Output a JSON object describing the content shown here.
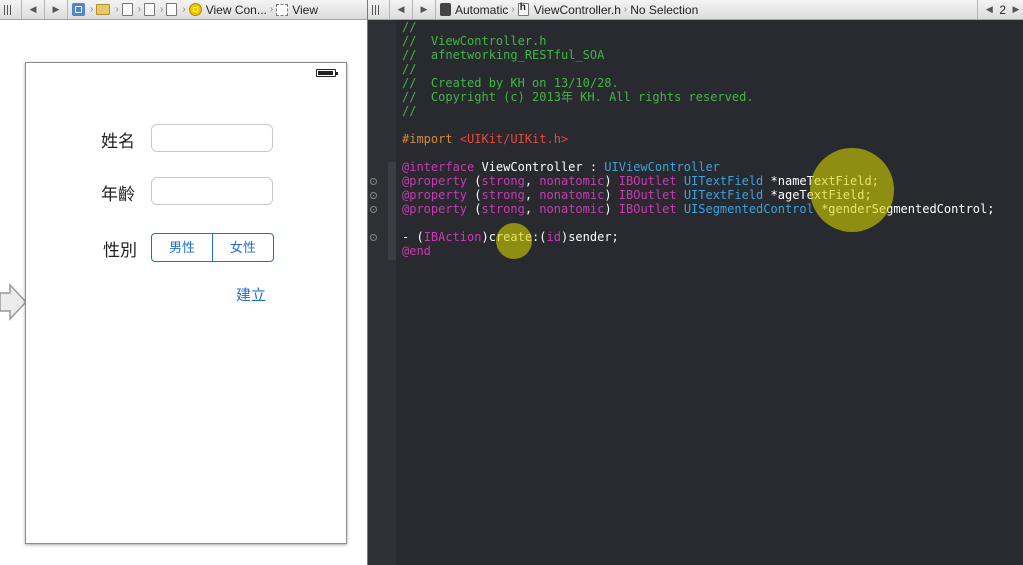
{
  "left_jumpbar": {
    "breadcrumb_vc": "View Con...",
    "breadcrumb_view": "View"
  },
  "right_jumpbar": {
    "automatic": "Automatic",
    "file": "ViewController.h",
    "selection": "No Selection",
    "counterpart_count": "2"
  },
  "form": {
    "name_label": "姓名",
    "age_label": "年齡",
    "gender_label": "性別",
    "segments": [
      "男性",
      "女性"
    ],
    "create_label": "建立"
  },
  "code": {
    "lines": [
      [
        {
          "t": "//",
          "c": "comment"
        }
      ],
      [
        {
          "t": "//  ViewController.h",
          "c": "comment"
        }
      ],
      [
        {
          "t": "//  afnetworking_RESTful_SOA",
          "c": "comment"
        }
      ],
      [
        {
          "t": "//",
          "c": "comment"
        }
      ],
      [
        {
          "t": "//  Created by KH on 13/10/28.",
          "c": "comment"
        }
      ],
      [
        {
          "t": "//  Copyright (c) 2013年 KH. All rights reserved.",
          "c": "comment"
        }
      ],
      [
        {
          "t": "//",
          "c": "comment"
        }
      ],
      [],
      [
        {
          "t": "#import ",
          "c": "pre"
        },
        {
          "t": "<UIKit/UIKit.h>",
          "c": "str"
        }
      ],
      [],
      [
        {
          "t": "@interface",
          "c": "kw"
        },
        {
          "t": " ViewController : ",
          "c": "id"
        },
        {
          "t": "UIViewController",
          "c": "cls"
        }
      ],
      [
        {
          "t": "@property",
          "c": "kw"
        },
        {
          "t": " (",
          "c": "id"
        },
        {
          "t": "strong",
          "c": "kw"
        },
        {
          "t": ", ",
          "c": "id"
        },
        {
          "t": "nonatomic",
          "c": "kw"
        },
        {
          "t": ") ",
          "c": "id"
        },
        {
          "t": "IBOutlet",
          "c": "kw"
        },
        {
          "t": " ",
          "c": "id"
        },
        {
          "t": "UITextField",
          "c": "cls"
        },
        {
          "t": " *nameTextField;",
          "c": "id"
        }
      ],
      [
        {
          "t": "@property",
          "c": "kw"
        },
        {
          "t": " (",
          "c": "id"
        },
        {
          "t": "strong",
          "c": "kw"
        },
        {
          "t": ", ",
          "c": "id"
        },
        {
          "t": "nonatomic",
          "c": "kw"
        },
        {
          "t": ") ",
          "c": "id"
        },
        {
          "t": "IBOutlet",
          "c": "kw"
        },
        {
          "t": " ",
          "c": "id"
        },
        {
          "t": "UITextField",
          "c": "cls"
        },
        {
          "t": " *ageTextField;",
          "c": "id"
        }
      ],
      [
        {
          "t": "@property",
          "c": "kw"
        },
        {
          "t": " (",
          "c": "id"
        },
        {
          "t": "strong",
          "c": "kw"
        },
        {
          "t": ", ",
          "c": "id"
        },
        {
          "t": "nonatomic",
          "c": "kw"
        },
        {
          "t": ") ",
          "c": "id"
        },
        {
          "t": "IBOutlet",
          "c": "kw"
        },
        {
          "t": " ",
          "c": "id"
        },
        {
          "t": "UISegmentedControl",
          "c": "cls"
        },
        {
          "t": " *genderSegmentedControl;",
          "c": "id"
        }
      ],
      [],
      [
        {
          "t": "- (",
          "c": "id"
        },
        {
          "t": "IBAction",
          "c": "kw"
        },
        {
          "t": ")create:(",
          "c": "id"
        },
        {
          "t": "id",
          "c": "kw"
        },
        {
          "t": ")sender;",
          "c": "id"
        }
      ],
      [
        {
          "t": "@end",
          "c": "kw"
        }
      ]
    ]
  },
  "colors": {
    "editor_bg": "#292a30",
    "comment": "#41b645",
    "keyword": "#c83bb0",
    "class": "#38a4dd",
    "string": "#e54a3b",
    "preprocessor": "#d48a3c",
    "ios_tint": "#1d6fd1",
    "click_highlight": "#d2d200"
  }
}
